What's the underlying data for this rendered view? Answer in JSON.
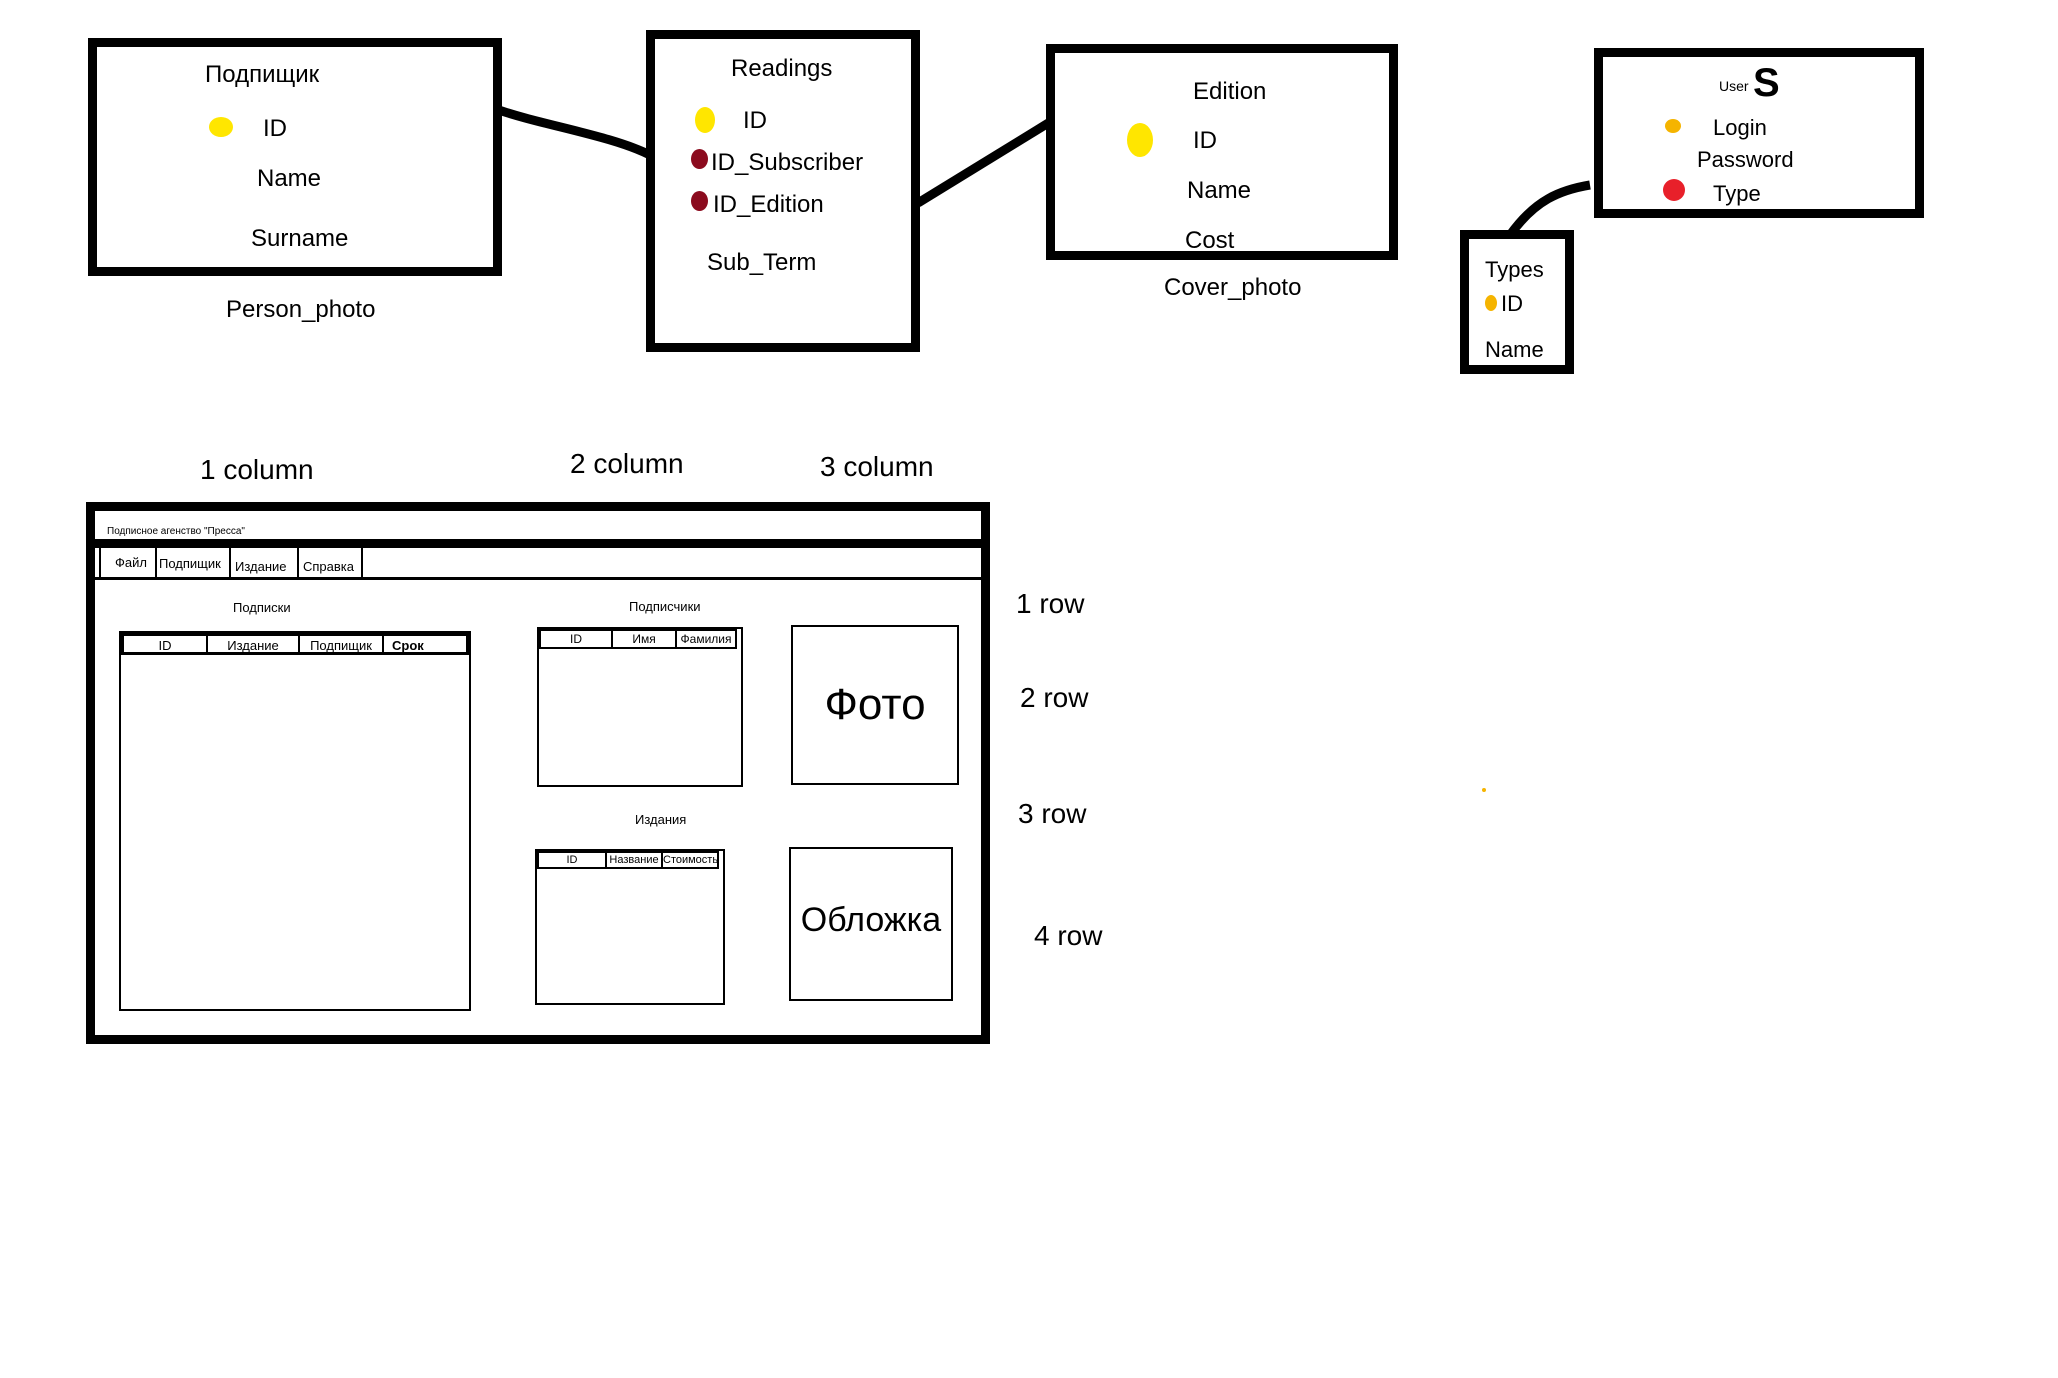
{
  "colors": {
    "stroke": "#000000",
    "pk_dot": "#ffe600",
    "fk_dot": "#8b0b1e",
    "login_dot": "#f5b400",
    "type_dot": "#e8202a"
  },
  "entities": {
    "subscriber": {
      "title": "Подпищик",
      "fields": [
        "ID",
        "Name",
        "Surname"
      ],
      "caption": "Person_photo"
    },
    "readings": {
      "title": "Readings",
      "fields": [
        "ID",
        "ID_Subscriber",
        "ID_Edition",
        "Sub_Term"
      ]
    },
    "edition": {
      "title": "Edition",
      "fields": [
        "ID",
        "Name",
        "Cost"
      ],
      "caption": "Cover_photo"
    },
    "users": {
      "title": "User",
      "title_suffix": "S",
      "fields": [
        "Login",
        "Password",
        "Type"
      ]
    },
    "types": {
      "title": "Types",
      "fields": [
        "ID",
        "Name"
      ]
    }
  },
  "layout_labels": {
    "columns": [
      "1 column",
      "2 column",
      "3 column"
    ],
    "rows": [
      "1 row",
      "2 row",
      "3 row",
      "4 row"
    ]
  },
  "mockup": {
    "window_title": "Подписное агенство \"Пресса\"",
    "menu": [
      "Файл",
      "Подпищик",
      "Издание",
      "Справка"
    ],
    "subscriptions": {
      "title": "Подписки",
      "columns": [
        "ID",
        "Издание",
        "Подпищик",
        "Срок"
      ]
    },
    "subscribers": {
      "title": "Подписчики",
      "columns": [
        "ID",
        "Имя",
        "Фамилия"
      ]
    },
    "editions": {
      "title": "Издания",
      "columns": [
        "ID",
        "Название",
        "Стоимость"
      ]
    },
    "photo_label": "Фото",
    "cover_label": "Обложка"
  }
}
